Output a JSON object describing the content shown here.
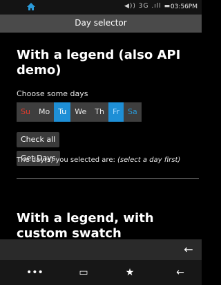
{
  "statusbar": {
    "icons": "◀)) 3G .ıll ▬",
    "time": "03:56PM"
  },
  "titlebar": {
    "title": "Day selector"
  },
  "section1": {
    "heading_line1": "With a legend (also API",
    "heading_line2": "demo)",
    "choose_label": "Choose some days",
    "days": [
      {
        "label": "Su",
        "selected": false,
        "color": "#e43b2d"
      },
      {
        "label": "Mo",
        "selected": false,
        "color": "#eaeaea"
      },
      {
        "label": "Tu",
        "selected": true,
        "color": "#ffffff"
      },
      {
        "label": "We",
        "selected": false,
        "color": "#eaeaea"
      },
      {
        "label": "Th",
        "selected": false,
        "color": "#eaeaea"
      },
      {
        "label": "Fr",
        "selected": true,
        "color": "#a9dbff"
      },
      {
        "label": "Sa",
        "selected": false,
        "color": "#2a9ad9"
      }
    ],
    "check_all_label": "Check all",
    "get_days_label": "Get Days",
    "result_prefix": "The day(s) you selected are: ",
    "result_value": "(select a day first)"
  },
  "section2": {
    "heading_line1": "With a legend, with",
    "heading_line2": "custom swatch"
  },
  "bottom": {
    "back_glyph": "←"
  },
  "navbar": {
    "more": "•••",
    "windows": "▭",
    "bookmark": "★",
    "back": "←"
  }
}
